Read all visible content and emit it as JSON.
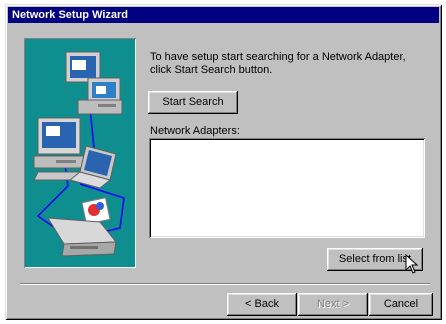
{
  "window": {
    "title": "Network Setup Wizard"
  },
  "main": {
    "instruction": "To have setup start searching for a Network Adapter, click Start Search button.",
    "start_search_label": "Start Search",
    "list_label": "Network Adapters:",
    "adapters": [],
    "select_from_list_label": "Select from list"
  },
  "footer": {
    "back_label": "< Back",
    "next_label": "Next >",
    "cancel_label": "Cancel"
  },
  "colors": {
    "titlebar": "#000080",
    "face": "#c0c0c0",
    "illustration_bg": "#0e8e8e",
    "network_cable": "#0000ff"
  },
  "icons": [
    "desktop-computer-icon",
    "laptop-icon",
    "printer-icon",
    "mouse-pointer-icon"
  ]
}
